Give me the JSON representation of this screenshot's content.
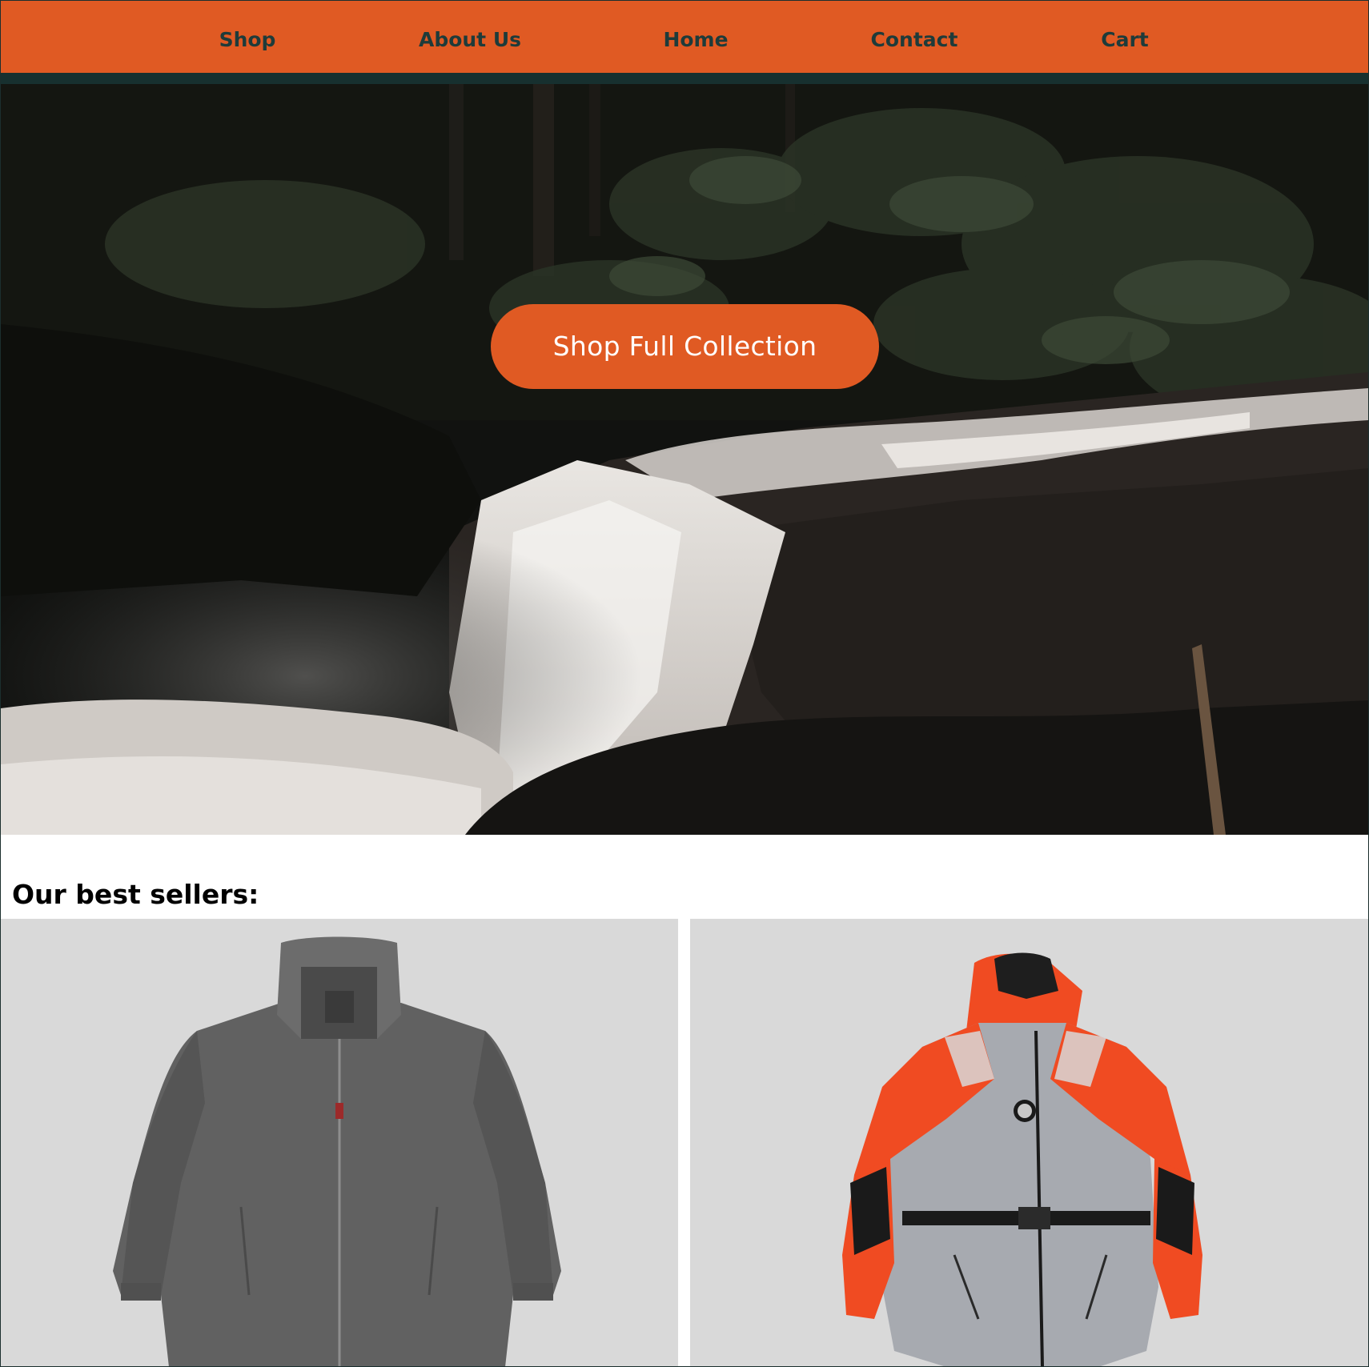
{
  "nav": {
    "items": [
      {
        "label": "Shop"
      },
      {
        "label": "About Us"
      },
      {
        "label": "Home"
      },
      {
        "label": "Contact"
      },
      {
        "label": "Cart"
      }
    ]
  },
  "hero": {
    "button_label": "Shop Full Collection",
    "image": "forest-waterfall-photo"
  },
  "best_sellers": {
    "title": "Our best sellers:",
    "products": [
      {
        "image": "grey-jacket-photo"
      },
      {
        "image": "orange-grey-float-coat-photo"
      }
    ]
  },
  "colors": {
    "accent": "#e05a23",
    "nav_text": "#1e3b3a",
    "divider": "#17302f",
    "card_bg": "#d9d9d9"
  }
}
